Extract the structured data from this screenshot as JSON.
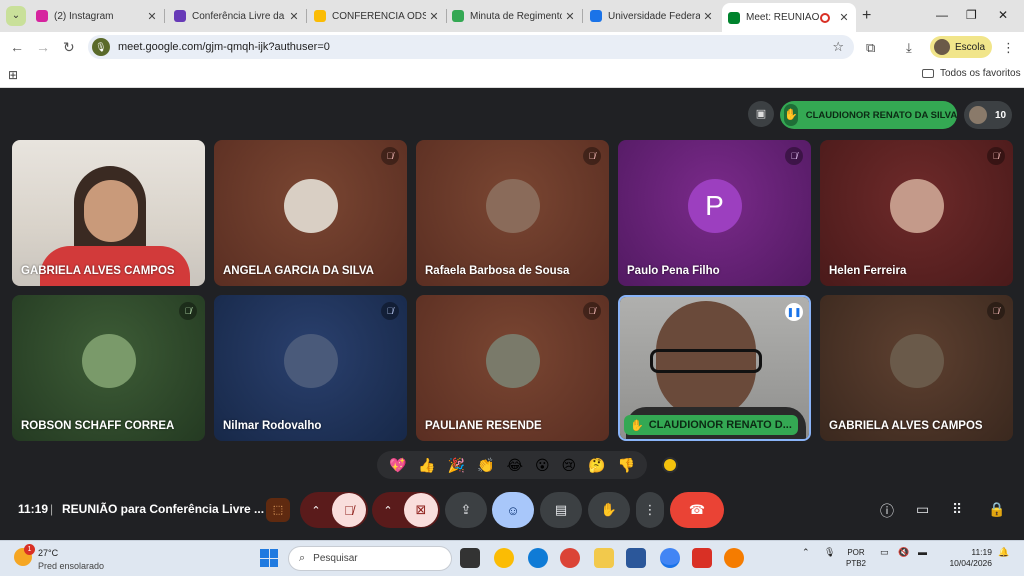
{
  "browser": {
    "tabs": [
      {
        "title": "(2) Instagram",
        "color": "#d6249f"
      },
      {
        "title": "Conferência Livre da",
        "color": "#673ab7"
      },
      {
        "title": "CONFERÊNCIA ODS -",
        "color": "#1a73e8"
      },
      {
        "title": "Minuta de Regimento",
        "color": "#1a73e8"
      },
      {
        "title": "Universidade Federal",
        "color": "#1a73e8"
      },
      {
        "title": "Meet: REUNIÃO p",
        "color": "#00832d"
      }
    ],
    "url": "meet.google.com/gjm-qmqh-ijk?authuser=0",
    "profile_label": "Escola",
    "bookmarks_folder": "Todos os favoritos"
  },
  "meet": {
    "presenter_name": "CLAUDIONOR RENATO DA SILVA",
    "participant_count": "10",
    "tiles": [
      {
        "name": "GABRIELA ALVES CAMPOS",
        "bg": "#c9c4bd",
        "kind": "video"
      },
      {
        "name": "ANGELA GARCIA DA SILVA",
        "bg": "#6b3a2a",
        "kind": "avatar",
        "avatar_color": "#d9cfc4"
      },
      {
        "name": "Rafaela Barbosa de Sousa",
        "bg": "#6a3b2a",
        "kind": "avatar",
        "avatar_color": "#8a6b5a"
      },
      {
        "name": "Paulo Pena Filho",
        "bg": "#6a1f7a",
        "kind": "letter",
        "letter": "P"
      },
      {
        "name": "Helen Ferreira",
        "bg": "#5e2323",
        "kind": "avatar",
        "avatar_color": "#c49a8a"
      },
      {
        "name": "ROBSON SCHAFF CORREA",
        "bg": "#2d4a2a",
        "kind": "avatar",
        "avatar_color": "#7a9a6a"
      },
      {
        "name": "Nilmar Rodovalho",
        "bg": "#1d2f55",
        "kind": "avatar",
        "avatar_color": "#4a5a7a"
      },
      {
        "name": "PAULIANE RESENDE",
        "bg": "#5e3528",
        "kind": "avatar",
        "avatar_color": "#7a7a6a"
      },
      {
        "name": "CLAUDIONOR RENATO D...",
        "bg": "#9a9a98",
        "kind": "video"
      },
      {
        "name": "GABRIELA ALVES CAMPOS",
        "bg": "#4a3226",
        "kind": "avatar",
        "avatar_color": "#6a5a4a"
      }
    ],
    "reactions": [
      "💖",
      "👍",
      "🎉",
      "👏",
      "😂",
      "😮",
      "😢",
      "🤔",
      "👎"
    ],
    "clock": "11:19",
    "meeting_title": "REUNIÃO para Conferência Livre ..."
  },
  "taskbar": {
    "weather_temp": "27°C",
    "weather_desc": "Pred ensolarado",
    "weather_badge": "1",
    "search_placeholder": "Pesquisar",
    "lang_top": "POR",
    "lang_bottom": "PTB2",
    "time": "11:19",
    "date": "10/04/2026"
  }
}
